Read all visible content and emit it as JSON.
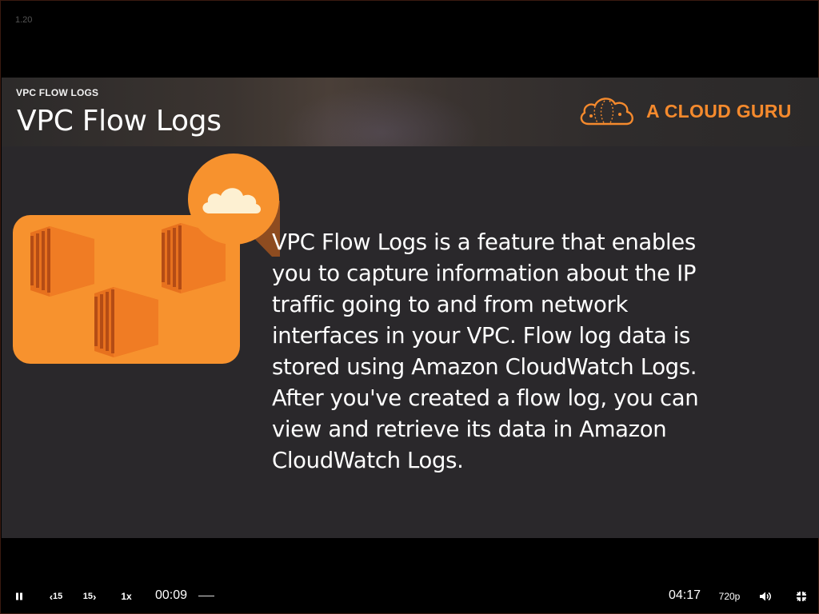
{
  "player": {
    "version": "1.20",
    "current_time": "00:09",
    "duration": "04:17",
    "quality": "720p",
    "speed": "1x",
    "rewind_label": "15",
    "forward_label": "15",
    "progress": 0.035
  },
  "slide": {
    "section_label": "VPC FLOW LOGS",
    "title": "VPC Flow Logs",
    "brand": "A CLOUD GURU",
    "body": "VPC Flow Logs is a feature that enables you to capture information about the IP traffic going to and from network interfaces in your VPC. Flow log data is stored using Amazon CloudWatch Logs. After you've created a flow log, you can view and retrieve its data in Amazon CloudWatch Logs.",
    "body_lines": [
      "VPC Flow Logs is a feature that enables",
      "you to capture information about the IP",
      "traffic going to and from network",
      "interfaces in your VPC. Flow log data is",
      "stored using Amazon CloudWatch Logs.",
      "After you've created a flow log, you can",
      "view and retrieve its data in Amazon",
      "CloudWatch Logs."
    ]
  },
  "icons": {
    "play_pause": "pause-icon",
    "rewind": "rewind-15-icon",
    "forward": "forward-15-icon",
    "volume": "volume-icon",
    "exit_fullscreen": "exit-fullscreen-icon",
    "brand_logo": "cloud-guru-logo-icon",
    "illustration": "vpc-flow-logs-illustration"
  },
  "colors": {
    "accent_orange": "#f58a2d",
    "illustration_orange": "#f7922e",
    "illustration_dark": "#c8541a",
    "slide_background": "#2a282b"
  }
}
